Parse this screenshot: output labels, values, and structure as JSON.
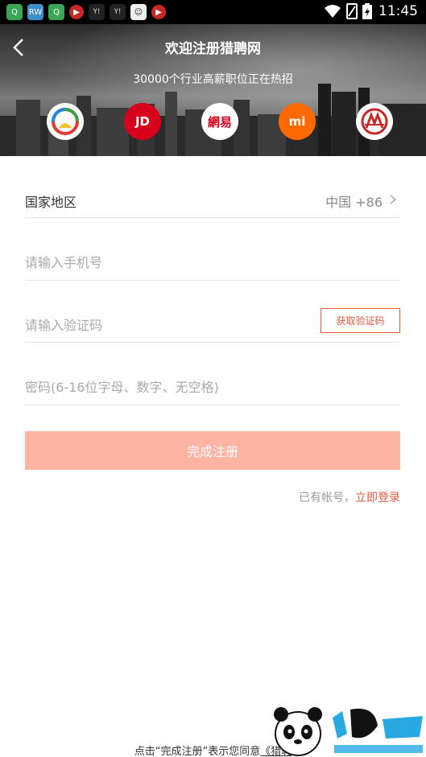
{
  "status_bar": {
    "time": "11:45",
    "app_icons": [
      "Q",
      "RW",
      "Q",
      "▶",
      "Y!",
      "Y!",
      "☺",
      "▶"
    ]
  },
  "header": {
    "title": "欢迎注册猎聘网",
    "subtitle": "30000个行业高薪职位正在热招",
    "logos": [
      {
        "name": "partner-logo-1",
        "text": ""
      },
      {
        "name": "jd-logo",
        "text": "JD"
      },
      {
        "name": "netease-logo",
        "text": "網易"
      },
      {
        "name": "xiaomi-logo",
        "text": "mi"
      },
      {
        "name": "partner-logo-5",
        "text": ""
      }
    ]
  },
  "form": {
    "country_label": "国家地区",
    "country_value": "中国 +86",
    "phone_placeholder": "请输入手机号",
    "code_placeholder": "请输入验证码",
    "get_code_label": "获取验证码",
    "password_placeholder": "密码(6-16位字母、数字、无空格)",
    "submit_label": "完成注册"
  },
  "login": {
    "prefix": "已有帐号，",
    "link": "立即登录"
  },
  "footer": {
    "prefix": "点击“完成注册”表示您同意",
    "link": "《猎聘"
  },
  "colors": {
    "accent": "#e8593f",
    "submit_bg": "#ffb3a2"
  }
}
